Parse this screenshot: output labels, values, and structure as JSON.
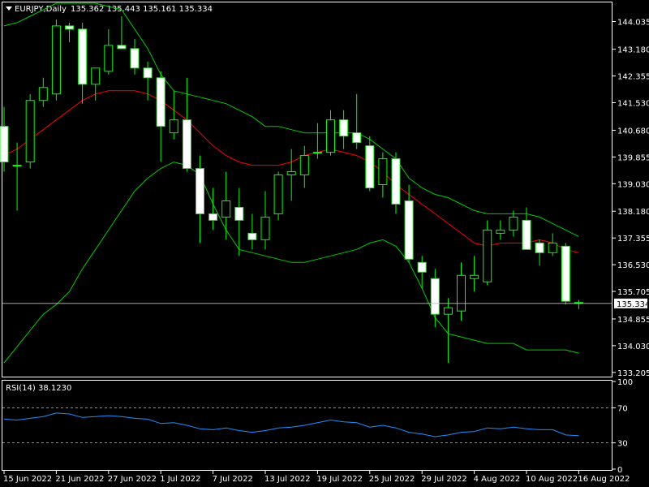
{
  "header": {
    "symbol": "EURJPY,Daily",
    "ohlc": "135.362 135.443 135.161 135.334"
  },
  "price_axis": {
    "ticks": [
      "144.035",
      "143.180",
      "142.355",
      "141.530",
      "140.680",
      "139.855",
      "139.030",
      "138.180",
      "137.355",
      "136.530",
      "135.705",
      "134.855",
      "134.030",
      "133.205"
    ],
    "current_price_label": "135.334",
    "current_price": 135.334,
    "range": [
      133.1,
      144.6
    ]
  },
  "rsi": {
    "label": "RSI(14) 38.1230",
    "ticks": [
      "100",
      "70",
      "30",
      "0"
    ],
    "levels": [
      70,
      30
    ],
    "range": [
      0,
      100
    ]
  },
  "time_axis": {
    "labels": [
      {
        "i": 0,
        "text": "15 Jun 2022"
      },
      {
        "i": 4,
        "text": "21 Jun 2022"
      },
      {
        "i": 8,
        "text": "27 Jun 2022"
      },
      {
        "i": 12,
        "text": "1 Jul 2022"
      },
      {
        "i": 16,
        "text": "7 Jul 2022"
      },
      {
        "i": 20,
        "text": "13 Jul 2022"
      },
      {
        "i": 24,
        "text": "19 Jul 2022"
      },
      {
        "i": 28,
        "text": "25 Jul 2022"
      },
      {
        "i": 32,
        "text": "29 Jul 2022"
      },
      {
        "i": 36,
        "text": "4 Aug 2022"
      },
      {
        "i": 40,
        "text": "10 Aug 2022"
      },
      {
        "i": 44,
        "text": "16 Aug 2022"
      }
    ]
  },
  "colors": {
    "background": "#000000",
    "bull": "#00ff00",
    "bear_fill": "#ffffff",
    "ma": "#ff0000",
    "bands": "#00cc00",
    "rsi_line": "#1e90ff",
    "grid_level": "#bbbbbb",
    "price_line": "#c0c0c0"
  },
  "chart_data": {
    "type": "candlestick",
    "x": [
      "15 Jun 2022",
      "16 Jun 2022",
      "17 Jun 2022",
      "20 Jun 2022",
      "21 Jun 2022",
      "22 Jun 2022",
      "23 Jun 2022",
      "24 Jun 2022",
      "27 Jun 2022",
      "28 Jun 2022",
      "29 Jun 2022",
      "30 Jun 2022",
      "1 Jul 2022",
      "4 Jul 2022",
      "5 Jul 2022",
      "6 Jul 2022",
      "7 Jul 2022",
      "8 Jul 2022",
      "11 Jul 2022",
      "12 Jul 2022",
      "13 Jul 2022",
      "14 Jul 2022",
      "15 Jul 2022",
      "18 Jul 2022",
      "19 Jul 2022",
      "20 Jul 2022",
      "21 Jul 2022",
      "22 Jul 2022",
      "25 Jul 2022",
      "26 Jul 2022",
      "27 Jul 2022",
      "28 Jul 2022",
      "29 Jul 2022",
      "1 Aug 2022",
      "2 Aug 2022",
      "3 Aug 2022",
      "4 Aug 2022",
      "5 Aug 2022",
      "8 Aug 2022",
      "9 Aug 2022",
      "10 Aug 2022",
      "11 Aug 2022",
      "12 Aug 2022",
      "15 Aug 2022",
      "16 Aug 2022"
    ],
    "ohlc": [
      [
        140.8,
        141.4,
        139.4,
        139.7
      ],
      [
        139.6,
        140.3,
        138.2,
        139.6
      ],
      [
        139.7,
        141.8,
        139.5,
        141.6
      ],
      [
        141.6,
        142.3,
        141.4,
        142.0
      ],
      [
        141.8,
        144.1,
        141.6,
        143.9
      ],
      [
        143.9,
        144.0,
        143.4,
        143.8
      ],
      [
        143.8,
        144.0,
        141.5,
        142.1
      ],
      [
        142.1,
        142.6,
        141.6,
        142.6
      ],
      [
        142.5,
        143.8,
        142.4,
        143.3
      ],
      [
        143.3,
        144.2,
        143.2,
        143.2
      ],
      [
        143.2,
        143.5,
        142.4,
        142.6
      ],
      [
        142.6,
        142.8,
        141.6,
        142.3
      ],
      [
        142.3,
        142.5,
        139.7,
        140.8
      ],
      [
        140.6,
        141.9,
        140.4,
        141.0
      ],
      [
        141.0,
        142.3,
        139.4,
        139.5
      ],
      [
        139.5,
        139.9,
        137.2,
        138.1
      ],
      [
        138.1,
        138.9,
        137.6,
        137.9
      ],
      [
        138.0,
        139.4,
        137.3,
        138.5
      ],
      [
        138.3,
        138.9,
        136.8,
        137.9
      ],
      [
        137.5,
        138.1,
        137.0,
        137.3
      ],
      [
        137.3,
        138.8,
        137.0,
        138.0
      ],
      [
        138.1,
        139.4,
        137.9,
        139.3
      ],
      [
        139.3,
        140.1,
        138.5,
        139.4
      ],
      [
        139.3,
        140.2,
        138.9,
        139.9
      ],
      [
        140.0,
        140.9,
        139.8,
        140.0
      ],
      [
        140.0,
        141.3,
        139.9,
        141.0
      ],
      [
        141.0,
        141.3,
        140.1,
        140.5
      ],
      [
        140.6,
        141.8,
        140.1,
        140.3
      ],
      [
        140.2,
        140.5,
        138.8,
        138.9
      ],
      [
        139.0,
        140.0,
        138.6,
        139.8
      ],
      [
        139.8,
        140.0,
        138.1,
        138.4
      ],
      [
        138.5,
        139.0,
        136.6,
        136.7
      ],
      [
        136.6,
        136.8,
        135.8,
        136.3
      ],
      [
        136.1,
        136.4,
        134.6,
        135.0
      ],
      [
        135.0,
        135.5,
        133.5,
        135.2
      ],
      [
        135.1,
        136.6,
        134.8,
        136.2
      ],
      [
        136.1,
        136.8,
        135.7,
        136.2
      ],
      [
        136.0,
        137.9,
        135.9,
        137.6
      ],
      [
        137.5,
        137.9,
        137.3,
        137.6
      ],
      [
        137.6,
        138.2,
        137.4,
        138.0
      ],
      [
        137.9,
        138.3,
        137.0,
        137.0
      ],
      [
        137.2,
        137.3,
        136.5,
        136.9
      ],
      [
        136.9,
        137.5,
        136.8,
        137.2
      ],
      [
        137.1,
        137.2,
        135.3,
        135.4
      ],
      [
        135.362,
        135.443,
        135.161,
        135.334
      ]
    ],
    "ma": [
      139.9,
      140.1,
      140.4,
      140.7,
      141.0,
      141.3,
      141.6,
      141.8,
      141.9,
      141.9,
      141.9,
      141.8,
      141.6,
      141.3,
      141.0,
      140.6,
      140.2,
      139.9,
      139.7,
      139.6,
      139.6,
      139.6,
      139.7,
      139.9,
      140.0,
      140.1,
      140.0,
      139.9,
      139.7,
      139.4,
      139.0,
      138.7,
      138.4,
      138.1,
      137.8,
      137.5,
      137.2,
      137.1,
      137.2,
      137.2,
      137.2,
      137.3,
      137.2,
      137.0,
      136.9
    ],
    "band_upper": [
      143.9,
      144.0,
      144.2,
      144.4,
      144.6,
      144.6,
      144.6,
      144.6,
      144.5,
      144.4,
      143.8,
      143.2,
      142.4,
      141.9,
      141.8,
      141.7,
      141.6,
      141.5,
      141.3,
      141.1,
      140.8,
      140.8,
      140.7,
      140.6,
      140.6,
      140.6,
      140.6,
      140.6,
      140.4,
      140.1,
      139.8,
      139.2,
      138.9,
      138.7,
      138.6,
      138.4,
      138.2,
      138.1,
      138.1,
      138.1,
      138.1,
      138.0,
      137.8,
      137.6,
      137.4
    ],
    "band_lower": [
      133.5,
      134.0,
      134.5,
      135.0,
      135.3,
      135.7,
      136.4,
      137.0,
      137.6,
      138.2,
      138.8,
      139.2,
      139.5,
      139.7,
      139.6,
      139.3,
      138.4,
      137.6,
      137.0,
      136.9,
      136.8,
      136.7,
      136.6,
      136.6,
      136.7,
      136.8,
      136.9,
      137.0,
      137.2,
      137.3,
      137.1,
      136.6,
      135.8,
      134.9,
      134.4,
      134.3,
      134.2,
      134.1,
      134.1,
      134.1,
      133.9,
      133.9,
      133.9,
      133.9,
      133.8
    ],
    "rsi": [
      57,
      56,
      58,
      60,
      64,
      63,
      59,
      60,
      61,
      60,
      58,
      57,
      52,
      53,
      50,
      46,
      45,
      47,
      44,
      42,
      44,
      47,
      48,
      50,
      53,
      56,
      54,
      53,
      48,
      50,
      47,
      42,
      40,
      37,
      39,
      42,
      43,
      47,
      46,
      48,
      46,
      45,
      45,
      39,
      38.123
    ]
  }
}
